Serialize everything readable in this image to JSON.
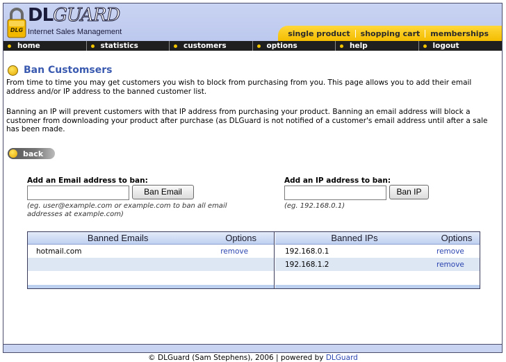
{
  "header": {
    "logo_main": "DL",
    "logo_accent": "GUARD",
    "logo_badge": "DLG",
    "tagline": "Internet Sales Management",
    "tabs": [
      "single product",
      "shopping cart",
      "memberships"
    ]
  },
  "nav": {
    "items": [
      "home",
      "statistics",
      "customers",
      "options",
      "help",
      "logout"
    ]
  },
  "page": {
    "title": "Ban Customsers",
    "intro": "From time to time you may get customers you wish to block from purchasing from you. This page allows you to add their email address and/or IP address to the banned customer list.",
    "explain": "Banning an IP will prevent customers with that IP address from purchasing your product. Banning an email address will block a customer from downloading your product after purchase (as DLGuard is not notified of a customer's email address until after a sale has been made.",
    "back_label": "back"
  },
  "email_form": {
    "label": "Add an Email address to ban:",
    "value": "",
    "button": "Ban Email",
    "hint": "(eg. user@example.com or example.com to ban all email addresses at example.com)"
  },
  "ip_form": {
    "label": "Add an IP address to ban:",
    "value": "",
    "button": "Ban IP",
    "hint": "(eg. 192.168.0.1)"
  },
  "emails_table": {
    "headers": [
      "Banned Emails",
      "Options"
    ],
    "rows": [
      {
        "value": "hotmail.com",
        "action": "remove"
      }
    ]
  },
  "ips_table": {
    "headers": [
      "Banned IPs",
      "Options"
    ],
    "rows": [
      {
        "value": "192.168.0.1",
        "action": "remove"
      },
      {
        "value": "192.168.1.2",
        "action": "remove"
      }
    ]
  },
  "footer": {
    "text": "© DLGuard (Sam Stephens), 2006 | powered by",
    "link": "DLGuard"
  },
  "colors": {
    "accent": "#3a5ab0",
    "header_bg": "#c9d3f2",
    "tab_yellow": "#f4bd00",
    "nav_bg": "#1f1f1f",
    "link": "#2a44b0"
  }
}
